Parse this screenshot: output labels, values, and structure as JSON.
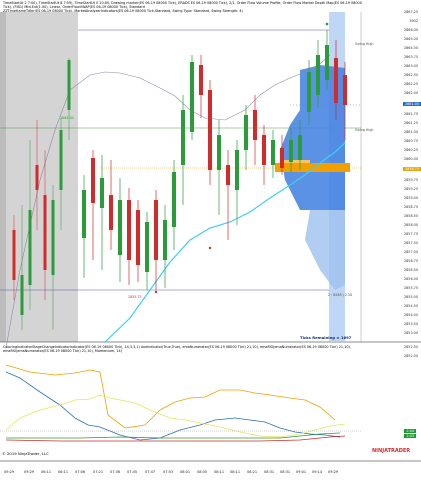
{
  "header": {
    "line1": "TimeStartUt 2   7:00), TimeStartUt 8   7:59), TimeStartUt 0   10:00, Drawing marker(ES 06-19 08000 Tick), ERADS ES 06-19 08000 Tick), 2/1, Order Flow Volume Profile, Order Flow Market Depth Map(ES 06-19 08000",
    "line2": "Tick), (FIB1) Mtd.Ext(1.00), Linear, OrderFlowVWAP(ES 06-19 08000 Tick), Standard",
    "line3": "ZZTimeframeTitler(ES 06-19 08000 Tick), MarketAnalyzerIndicators(ES 06-19 08000 Tick,Standard, Swing Type: Standard, Swing Strength: 4)"
  },
  "price_axis": {
    "labels": [
      "2867.25",
      "3902",
      "2866.00",
      "2865.00",
      "2864.50",
      "2863.75",
      "2863.00",
      "2862.50",
      "2862.25",
      "2862.00",
      "2861.75",
      "2861.25",
      "2861.00",
      "2860.75",
      "2860.25",
      "2860.00",
      "2859.75",
      "2859.25",
      "2859.00",
      "2858.75",
      "2858.50",
      "2858.00",
      "2857.75",
      "2857.50",
      "2857.00",
      "2856.75",
      "2856.50",
      "2856.00",
      "2855.75",
      "2855.00",
      "2854.50",
      "2854.00",
      "2853.50",
      "2853.00",
      "2852.50",
      "2852.00"
    ],
    "current_price": "2861.00",
    "current_color": "#2c6fbf",
    "last_price": "2858.75",
    "last_color": "#e3a21a"
  },
  "chart_labels": {
    "ticks_remaining": "Ticks Remaining = 1697",
    "copyright": "© 2019 NinjaTrader, LLC",
    "watermark": "NINJATRADER",
    "swing_high_label": "Swing High",
    "swing_low_label": "2855.75",
    "note_2862": "2863.50",
    "note_bottom": "2 : 8585 \\ 2.50"
  },
  "indicator_panel": {
    "title": "ColoringIndicatorStageChangeIndicatorIndicator(ES 06-19 08000 Tick), 14,3,3,1) AveIndicator(True,True), emaNumerator(ES 06-19 08000 Tick) 21,10), emaRSI(emaNumerator(ES 06-19 08000 Tick) 21,10), emaRSI(emaNumerator(ES 06-19 08000 Tick) 21,10), Momentum, 14)",
    "value1": "2.44",
    "value2": "2.03",
    "value1_color": "#1a9e2f",
    "value2_color": "#1a9e2f"
  },
  "time_axis": {
    "labels": [
      "09:29",
      "09:29",
      "06:11",
      "06:11",
      "07:06",
      "07:21",
      "07:36",
      "07:45",
      "07:47",
      "07:53",
      "08:01",
      "08:05",
      "08:11",
      "08:11",
      "08:21",
      "08:31",
      "08:31",
      "09:01",
      "09:14",
      "09:29"
    ]
  },
  "colors": {
    "up_candle": "#2a9d3a",
    "down_candle": "#d22b2b",
    "vwap": "#3ad0f0",
    "profile": "#3f7fe0",
    "poc": "#f2a000",
    "session_shade": "#d6d6d6"
  }
}
